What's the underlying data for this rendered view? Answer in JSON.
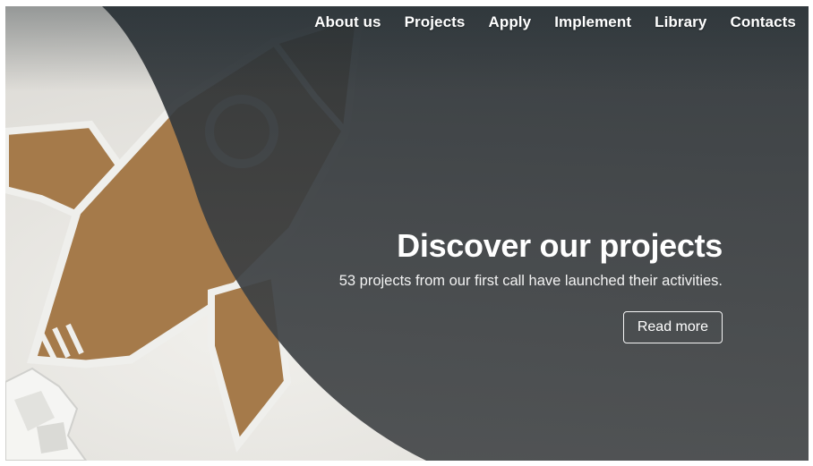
{
  "nav": {
    "items": [
      {
        "label": "About us"
      },
      {
        "label": "Projects"
      },
      {
        "label": "Apply"
      },
      {
        "label": "Implement"
      },
      {
        "label": "Library"
      },
      {
        "label": "Contacts"
      }
    ]
  },
  "hero": {
    "title": "Discover our projects",
    "subtitle": "53 projects from our first call have launched their activities.",
    "cta_label": "Read more"
  },
  "colors": {
    "overlay": "#3e4245",
    "cardboard": "#a57a4a",
    "paper": "#e9e7e2",
    "text": "#ffffff"
  }
}
